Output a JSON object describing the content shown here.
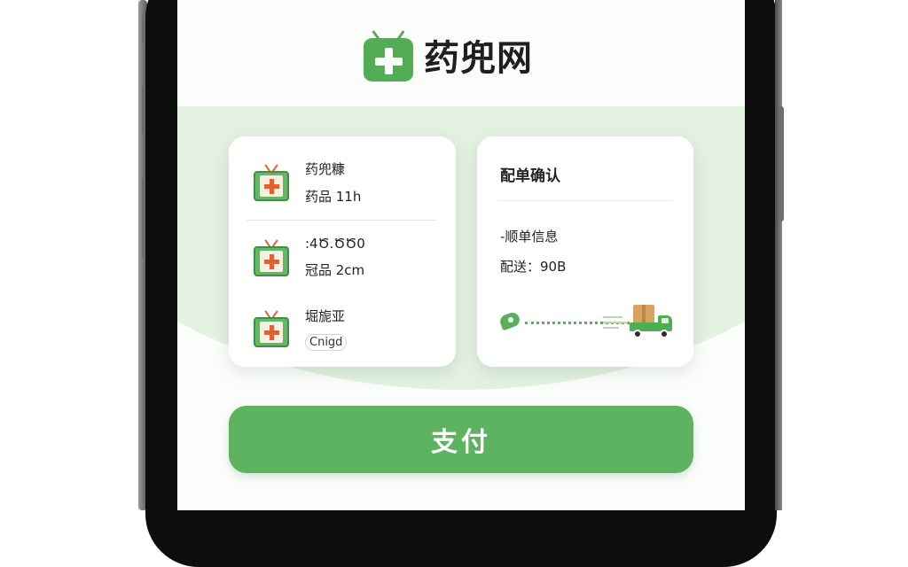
{
  "brand": {
    "title": "药兜网",
    "icon": "medical-tv-logo-icon"
  },
  "medicines": [
    {
      "name": "药兜糠",
      "detail": "药品 11h",
      "icon": "medicine-box-icon"
    },
    {
      "name": ":4Ծ.ԾԾ0",
      "detail": "冠品 2cm",
      "icon": "medicine-box-icon"
    },
    {
      "name": "堀旎亚",
      "detail": "Cnigd",
      "icon": "medicine-box-icon"
    }
  ],
  "confirmation": {
    "title": "配单确认",
    "info_label": "-顺单信息",
    "shipping": "配送：90B",
    "icons": [
      "location-pin-icon",
      "delivery-truck-icon"
    ]
  },
  "pay_button": {
    "label": "支付"
  },
  "colors": {
    "accent": "#5db360",
    "background_tint": "#e3f1e1",
    "cross": "#e0632f"
  }
}
